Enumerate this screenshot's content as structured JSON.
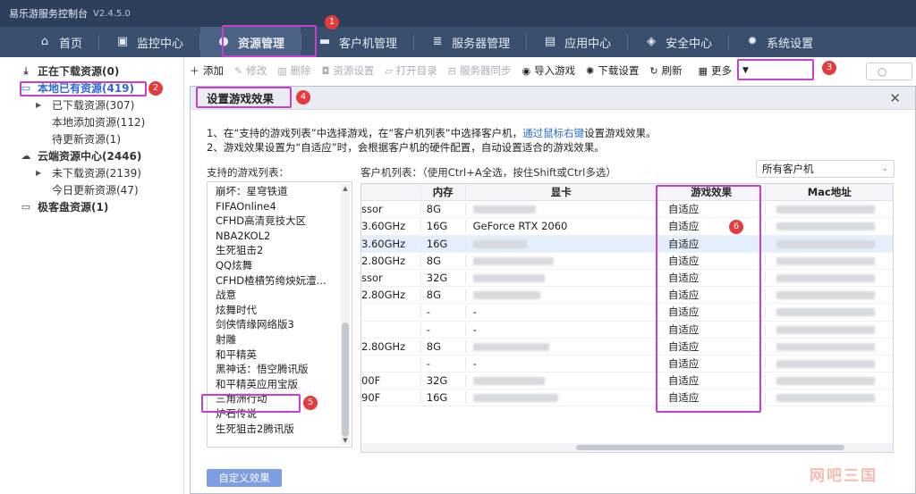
{
  "app": {
    "title": "易乐游服务控制台",
    "version": "V2.4.5.0"
  },
  "nav": [
    {
      "label": "首页",
      "icon": "home-icon",
      "glyph": "⌂"
    },
    {
      "label": "监控中心",
      "icon": "monitor-card-icon",
      "glyph": "▣"
    },
    {
      "label": "资源管理",
      "icon": "gamepad-icon",
      "glyph": "●"
    },
    {
      "label": "客户机管理",
      "icon": "desktop-icon",
      "glyph": "▬"
    },
    {
      "label": "服务器管理",
      "icon": "server-icon",
      "glyph": "≣"
    },
    {
      "label": "应用中心",
      "icon": "briefcase-icon",
      "glyph": "▤"
    },
    {
      "label": "安全中心",
      "icon": "shield-icon",
      "glyph": "◈"
    },
    {
      "label": "系统设置",
      "icon": "gear-icon",
      "glyph": "✹"
    }
  ],
  "sidebar": {
    "downloading": "正在下载资源(0)",
    "local": "本地已有资源(419)",
    "local_children": [
      "已下载资源(307)",
      "本地添加资源(112)",
      "待更新资源(1)"
    ],
    "cloud": "云端资源中心(2446)",
    "cloud_children": [
      "未下载资源(2139)",
      "今日更新资源(47)"
    ],
    "disk": "极客盘资源(1)"
  },
  "toolbar": {
    "add": "添加",
    "edit": "修改",
    "delete": "删除",
    "res_settings": "资源设置",
    "open_dir": "打开目录",
    "server_sync": "服务器同步",
    "import_game": "导入游戏",
    "download_settings": "下载设置",
    "refresh": "刷新",
    "more": "更多"
  },
  "modal": {
    "title": "设置游戏效果",
    "line1_a": "1、在“支持的游戏列表”中选择游戏，在“客户机列表”中选择客户机，",
    "line1_link": "通过鼠标右键",
    "line1_b": "设置游戏效果。",
    "line2": "2、游戏效果设置为“自适应”时，会根据客户机的硬件配置，自动设置适合的游戏效果。",
    "games_label": "支持的游戏列表：",
    "clients_label": "客户机列表：（使用Ctrl+A全选，按住Shift或Ctrl多选）",
    "client_filter": "所有客户机",
    "custom_button": "自定义效果"
  },
  "games": [
    "崩坏：星穹铁道",
    "FIFAOnline4",
    "CFHD高清竞技大区",
    "NBA2KOL2",
    "生死狙击2",
    "QQ炫舞",
    "CFHD楂樻竻绔炴妧澶...",
    "战意",
    "炫舞时代",
    "剑侠情缘网络版3",
    "射雕",
    "和平精英",
    "黑神话：悟空腾讯版",
    "和平精英应用宝版",
    "三角洲行动",
    "炉石传说",
    "生死狙击2腾讯版"
  ],
  "clients": {
    "headers": {
      "mem": "内存",
      "gpu": "显卡",
      "effect": "游戏效果",
      "mac": "Mac地址"
    },
    "rows": [
      {
        "cpu": "ssor",
        "mem": "8G",
        "gpu": "",
        "effect": "自适应"
      },
      {
        "cpu": "3.60GHz",
        "mem": "16G",
        "gpu": "GeForce RTX 2060",
        "effect": "自适应"
      },
      {
        "cpu": "3.60GHz",
        "mem": "16G",
        "gpu": "",
        "effect": "自适应"
      },
      {
        "cpu": "2.80GHz",
        "mem": "8G",
        "gpu": "",
        "effect": "自适应"
      },
      {
        "cpu": "ssor",
        "mem": "32G",
        "gpu": "",
        "effect": "自适应"
      },
      {
        "cpu": "2.80GHz",
        "mem": "8G",
        "gpu": "",
        "effect": "自适应"
      },
      {
        "cpu": "",
        "mem": "-",
        "gpu": "-",
        "effect": "自适应"
      },
      {
        "cpu": "",
        "mem": "-",
        "gpu": "-",
        "effect": "自适应"
      },
      {
        "cpu": "2.80GHz",
        "mem": "8G",
        "gpu": "",
        "effect": "自适应"
      },
      {
        "cpu": "",
        "mem": "-",
        "gpu": "-",
        "effect": "自适应"
      },
      {
        "cpu": "00F",
        "mem": "32G",
        "gpu": "",
        "effect": "自适应"
      },
      {
        "cpu": "90F",
        "mem": "16G",
        "gpu": "",
        "effect": "自适应"
      }
    ]
  },
  "annotations": [
    "1",
    "2",
    "3",
    "4",
    "5",
    "6"
  ],
  "watermark": "网吧三国",
  "colors": {
    "annotation": "#c63fd0",
    "badge": "#e43c3c",
    "accent": "#2a6bd8",
    "titlebar": "#2e3f5c",
    "nav": "#3a4e6e"
  }
}
